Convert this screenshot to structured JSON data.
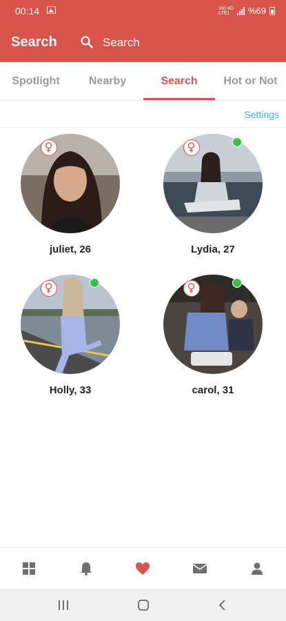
{
  "status_bar": {
    "time": "00:14",
    "network_line1": "Vo) 4G",
    "network_line2": "LTE1",
    "battery": "%69"
  },
  "header": {
    "title": "Search",
    "search_label": "Search"
  },
  "tabs": [
    {
      "label": "Spotlight",
      "active": false
    },
    {
      "label": "Nearby",
      "active": false
    },
    {
      "label": "Search",
      "active": true
    },
    {
      "label": "Hot or Not",
      "active": false
    }
  ],
  "settings_label": "Settings",
  "profiles": [
    {
      "name": "juliet, 26",
      "gender_icon": "female-icon",
      "online": false
    },
    {
      "name": "Lydia, 27",
      "gender_icon": "female-icon",
      "online": true
    },
    {
      "name": "Holly, 33",
      "gender_icon": "female-icon",
      "online": true
    },
    {
      "name": "carol, 31",
      "gender_icon": "female-icon",
      "online": true
    }
  ],
  "bottom_nav": [
    {
      "icon": "grid-icon",
      "active": false
    },
    {
      "icon": "bell-icon",
      "active": false
    },
    {
      "icon": "heart-icon",
      "active": true
    },
    {
      "icon": "mail-icon",
      "active": false
    },
    {
      "icon": "person-icon",
      "active": false
    }
  ],
  "system_nav": [
    "recents-icon",
    "home-icon",
    "back-icon"
  ],
  "colors": {
    "accent": "#d9534a",
    "link": "#3fb6dd",
    "online": "#35c24b",
    "inactive_tab": "#9a9a9a",
    "icon_gray": "#6f6f6f"
  }
}
